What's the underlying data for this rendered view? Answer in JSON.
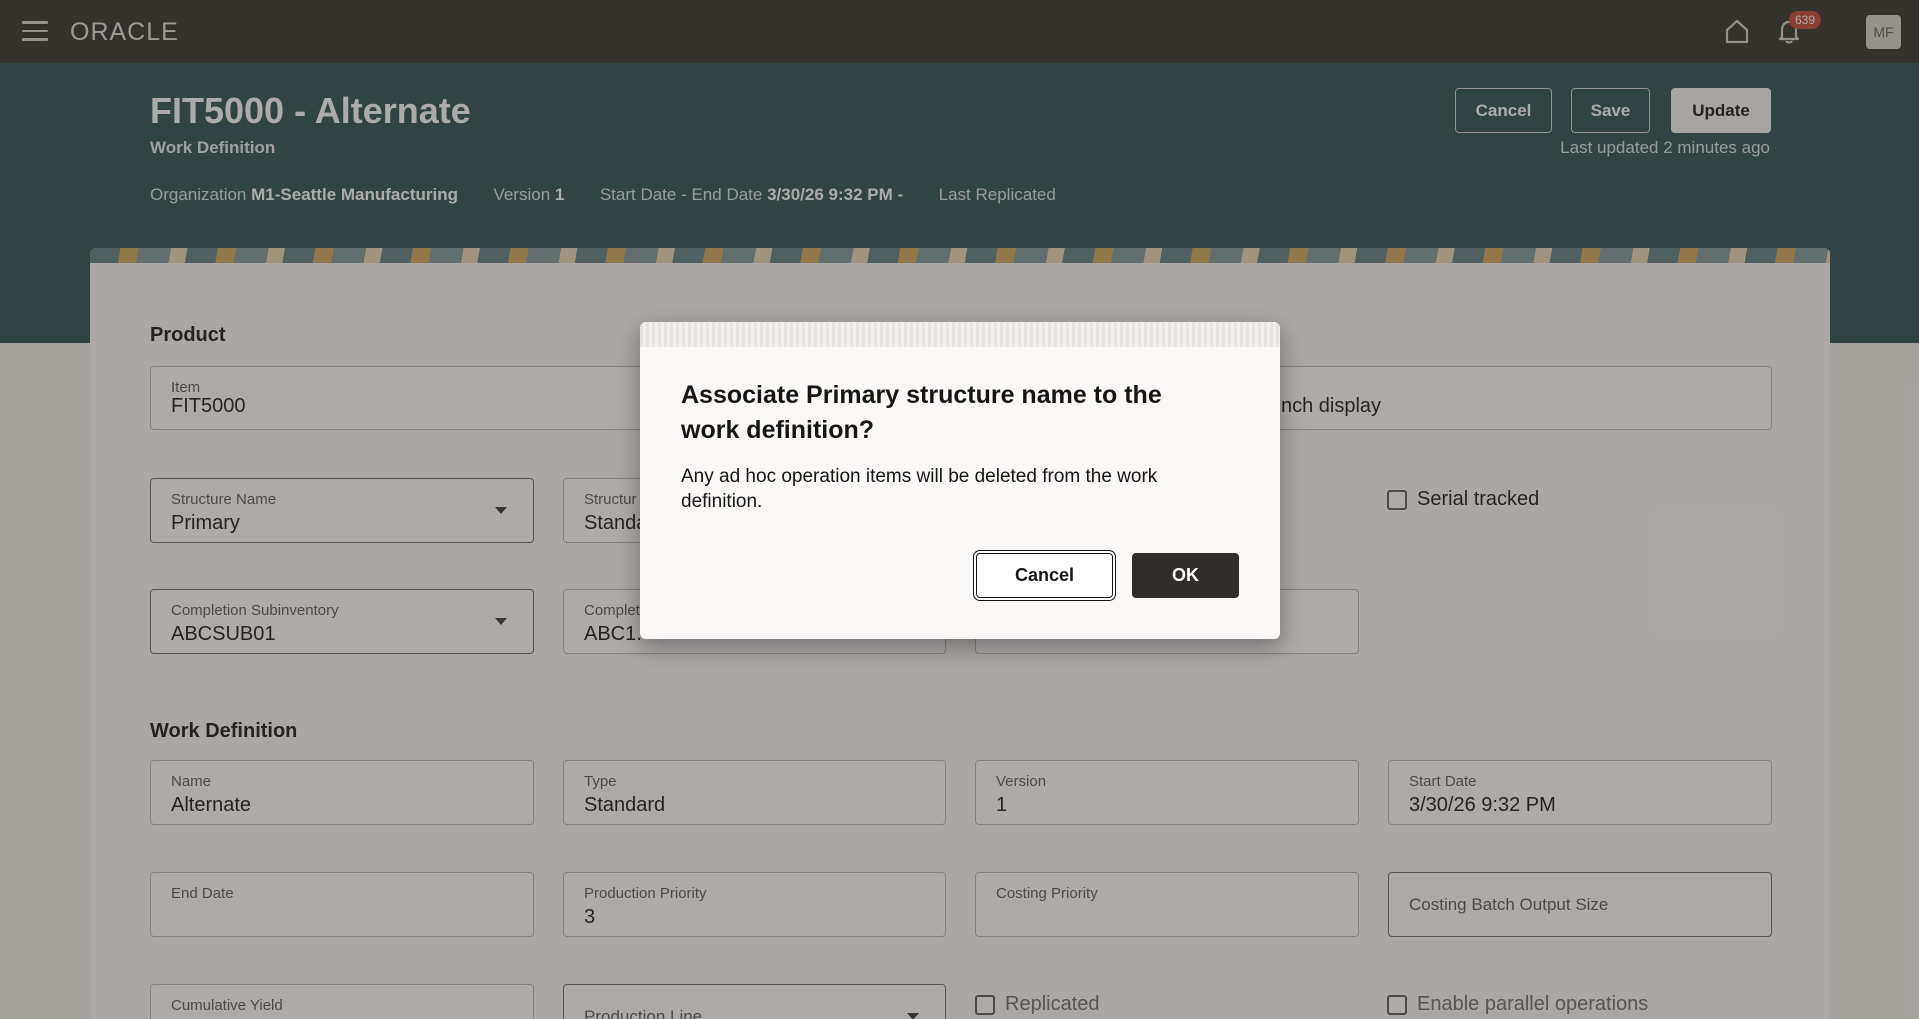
{
  "topbar": {
    "logo": "ORACLE",
    "notification_count": "639",
    "avatar_initials": "MF"
  },
  "header": {
    "title": "FIT5000 - Alternate",
    "subtitle": "Work Definition",
    "organization_label": "Organization",
    "organization_value": "M1-Seattle Manufacturing",
    "version_label": "Version",
    "version_value": "1",
    "dates_label": "Start Date - End Date",
    "dates_value": "3/30/26 9:32 PM -",
    "last_replicated_label": "Last Replicated",
    "cancel_label": "Cancel",
    "save_label": "Save",
    "update_label": "Update",
    "last_updated": "Last updated 2 minutes ago"
  },
  "product": {
    "section_title": "Product",
    "item_label": "Item",
    "item_value": "FIT5000",
    "batch_display_text": "nch display",
    "structure_name_label": "Structure Name",
    "structure_name_value": "Primary",
    "structure_type_label": "Structur",
    "structure_type_value": "Standa",
    "serial_tracked_label": "Serial tracked",
    "completion_subinventory_label": "Completion Subinventory",
    "completion_subinventory_value": "ABCSUB01",
    "completion_locator_label": "Complet",
    "completion_locator_value": "ABC1."
  },
  "work_definition": {
    "section_title": "Work Definition",
    "name_label": "Name",
    "name_value": "Alternate",
    "type_label": "Type",
    "type_value": "Standard",
    "version_label": "Version",
    "version_value": "1",
    "start_date_label": "Start Date",
    "start_date_value": "3/30/26 9:32 PM",
    "end_date_label": "End Date",
    "production_priority_label": "Production Priority",
    "production_priority_value": "3",
    "costing_priority_label": "Costing Priority",
    "costing_batch_output_size_label": "Costing Batch Output Size",
    "cumulative_yield_label": "Cumulative Yield",
    "production_line_label": "Production Line",
    "replicated_label": "Replicated",
    "enable_parallel_label": "Enable parallel operations"
  },
  "dialog": {
    "title": "Associate Primary structure name to the work definition?",
    "body": "Any ad hoc operation items will be deleted from the work definition.",
    "cancel_label": "Cancel",
    "ok_label": "OK"
  }
}
